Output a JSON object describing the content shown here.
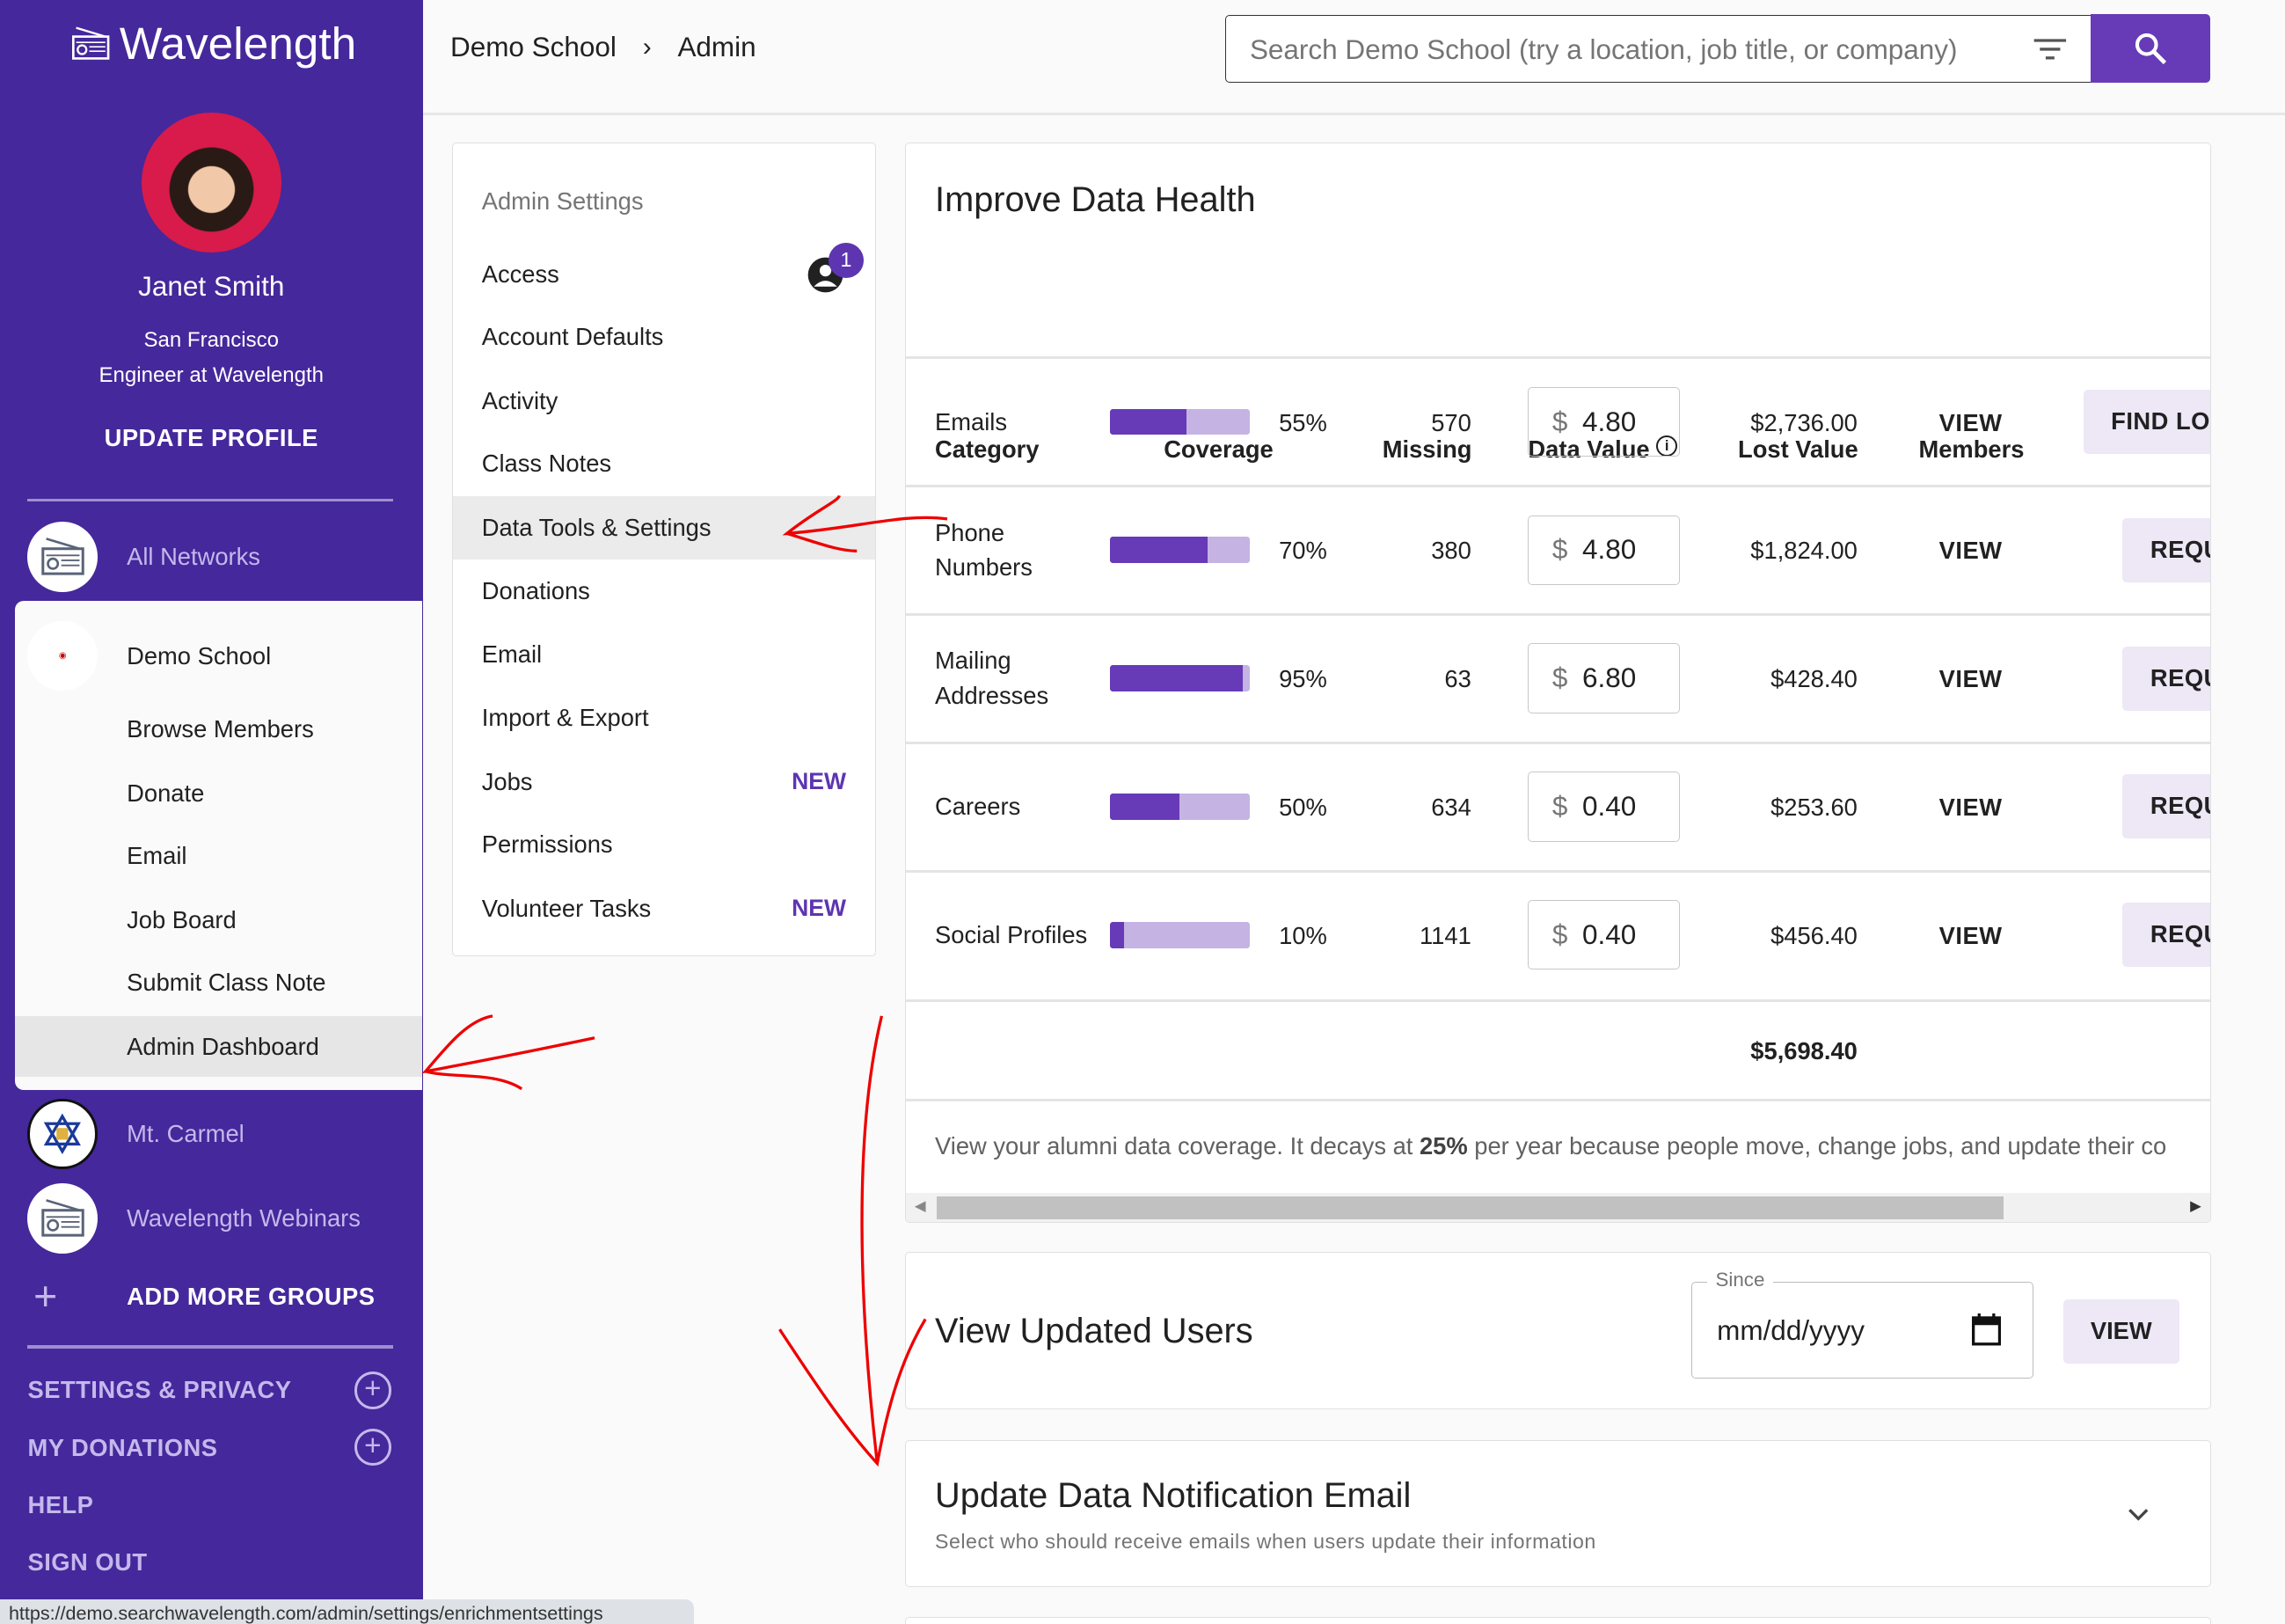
{
  "app": {
    "name": "Wavelength",
    "brand_color": "#45289b",
    "accent": "#673ab7"
  },
  "profile": {
    "name": "Janet Smith",
    "location": "San Francisco",
    "title": "Engineer at Wavelength",
    "update_label": "UPDATE PROFILE"
  },
  "networks": {
    "all": "All Networks",
    "current": {
      "name": "Demo School",
      "items": [
        "Browse Members",
        "Donate",
        "Email",
        "Job Board",
        "Submit Class Note",
        "Admin Dashboard"
      ],
      "active": "Admin Dashboard"
    },
    "others": [
      "Mt. Carmel",
      "Wavelength Webinars"
    ],
    "add_label": "ADD MORE GROUPS"
  },
  "sidebar_links": [
    "SETTINGS & PRIVACY",
    "MY DONATIONS",
    "HELP",
    "SIGN OUT"
  ],
  "status_url": "https://demo.searchwavelength.com/admin/settings/enrichmentsettings",
  "breadcrumb": [
    "Demo School",
    "Admin"
  ],
  "search": {
    "placeholder": "Search Demo School (try a location, job title, or company)"
  },
  "admin_settings": {
    "heading": "Admin Settings",
    "badge_count": "1",
    "items": [
      {
        "label": "Access"
      },
      {
        "label": "Account Defaults"
      },
      {
        "label": "Activity"
      },
      {
        "label": "Class Notes"
      },
      {
        "label": "Data Tools & Settings",
        "active": true
      },
      {
        "label": "Donations"
      },
      {
        "label": "Email"
      },
      {
        "label": "Import & Export"
      },
      {
        "label": "Jobs",
        "tag": "NEW"
      },
      {
        "label": "Permissions"
      },
      {
        "label": "Volunteer Tasks",
        "tag": "NEW"
      }
    ]
  },
  "data_health": {
    "title": "Improve Data Health",
    "columns": [
      "Category",
      "Coverage",
      "Missing",
      "Data Value",
      "Lost Value",
      "Members"
    ],
    "rows": [
      {
        "category": "Emails",
        "coverage": 55,
        "coverage_label": "55%",
        "missing": "570",
        "currency": "$",
        "value": "4.80",
        "lost": "$2,736.00",
        "members": "VIEW",
        "action": "FIND LOST"
      },
      {
        "category": "Phone Numbers",
        "coverage": 70,
        "coverage_label": "70%",
        "missing": "380",
        "currency": "$",
        "value": "4.80",
        "lost": "$1,824.00",
        "members": "VIEW",
        "action": "REQU"
      },
      {
        "category": "Mailing Addresses",
        "coverage": 95,
        "coverage_label": "95%",
        "missing": "63",
        "currency": "$",
        "value": "6.80",
        "lost": "$428.40",
        "members": "VIEW",
        "action": "REQU"
      },
      {
        "category": "Careers",
        "coverage": 50,
        "coverage_label": "50%",
        "missing": "634",
        "currency": "$",
        "value": "0.40",
        "lost": "$253.60",
        "members": "VIEW",
        "action": "REQU"
      },
      {
        "category": "Social Profiles",
        "coverage": 10,
        "coverage_label": "10%",
        "missing": "1141",
        "currency": "$",
        "value": "0.40",
        "lost": "$456.40",
        "members": "VIEW",
        "action": "REQU"
      }
    ],
    "total": "$5,698.40",
    "note_pre": "View your alumni data coverage. It decays at ",
    "note_bold": "25%",
    "note_post": " per year because people move, change jobs, and update their co"
  },
  "updated_users": {
    "title": "View Updated Users",
    "since_label": "Since",
    "date_placeholder": "mm/dd/yyyy",
    "view_label": "VIEW"
  },
  "notification": {
    "title": "Update Data Notification Email",
    "subtitle": "Select who should receive emails when users update their information"
  }
}
